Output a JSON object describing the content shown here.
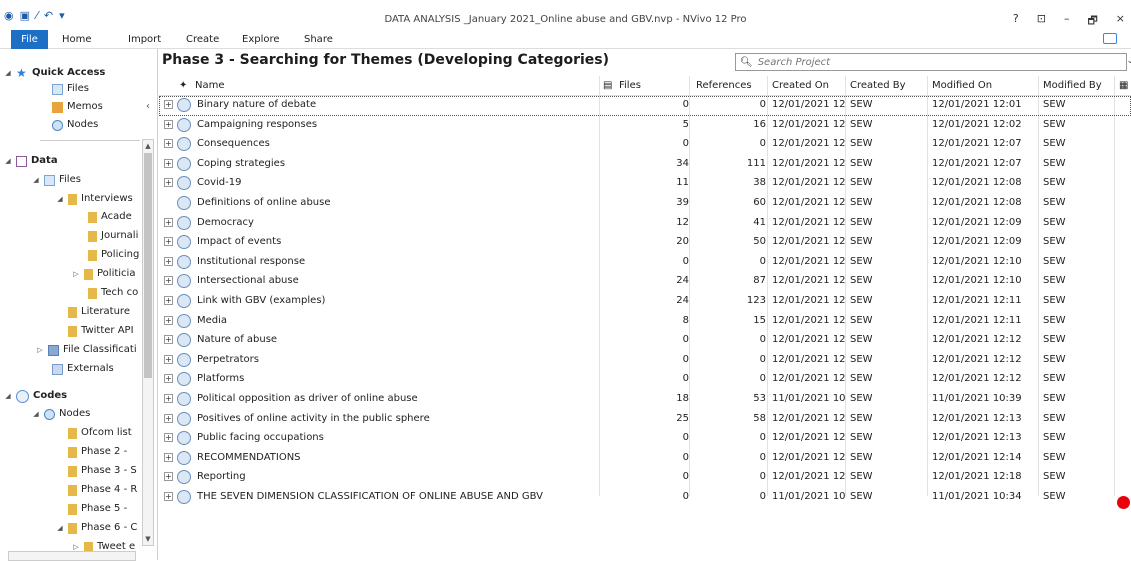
{
  "window": {
    "title": "DATA ANALYSIS _January 2021_Online abuse and GBV.nvp - NVivo 12 Pro",
    "controls": [
      "?",
      "⊡",
      "–",
      "🗗",
      "×"
    ]
  },
  "ribbon": {
    "tabs": [
      "File",
      "Home",
      "Import",
      "Create",
      "Explore",
      "Share"
    ]
  },
  "nav": {
    "quick_access": "Quick Access",
    "qa_files": "Files",
    "qa_memos": "Memos",
    "qa_nodes": "Nodes",
    "data": "Data",
    "files": "Files",
    "interviews": "Interviews",
    "acade": "Acade",
    "journali": "Journali",
    "policing": "Policing",
    "politicia": "Politicia",
    "tech": "Tech co",
    "literature": "Literature",
    "twitter": "Twitter API",
    "file_class": "File Classificati",
    "externals": "Externals",
    "codes": "Codes",
    "nodes": "Nodes",
    "ofcom": "Ofcom list",
    "phase2": "Phase 2 -",
    "phase3": "Phase 3 - S",
    "phase4": "Phase 4 - R",
    "phase5": "Phase 5 -",
    "phase6": "Phase 6 - C",
    "tweet": "Tweet e"
  },
  "main": {
    "title": "Phase 3 - Searching for Themes (Developing Categories)",
    "search_placeholder": "Search Project",
    "columns": {
      "name": "Name",
      "files": "Files",
      "references": "References",
      "created_on": "Created On",
      "created_by": "Created By",
      "modified_on": "Modified On",
      "modified_by": "Modified By"
    },
    "rows": [
      {
        "name": "Binary nature of debate",
        "files": "0",
        "refs": "0",
        "created_on": "12/01/2021 12",
        "created_by": "SEW",
        "modified_on": "12/01/2021 12:01",
        "modified_by": "SEW",
        "expand": true
      },
      {
        "name": "Campaigning responses",
        "files": "5",
        "refs": "16",
        "created_on": "12/01/2021 12",
        "created_by": "SEW",
        "modified_on": "12/01/2021 12:02",
        "modified_by": "SEW",
        "expand": true
      },
      {
        "name": "Consequences",
        "files": "0",
        "refs": "0",
        "created_on": "12/01/2021 12",
        "created_by": "SEW",
        "modified_on": "12/01/2021 12:07",
        "modified_by": "SEW",
        "expand": true
      },
      {
        "name": "Coping strategies",
        "files": "34",
        "refs": "111",
        "created_on": "12/01/2021 12",
        "created_by": "SEW",
        "modified_on": "12/01/2021 12:07",
        "modified_by": "SEW",
        "expand": true
      },
      {
        "name": "Covid-19",
        "files": "11",
        "refs": "38",
        "created_on": "12/01/2021 12",
        "created_by": "SEW",
        "modified_on": "12/01/2021 12:08",
        "modified_by": "SEW",
        "expand": true
      },
      {
        "name": "Definitions of online abuse",
        "files": "39",
        "refs": "60",
        "created_on": "12/01/2021 12",
        "created_by": "SEW",
        "modified_on": "12/01/2021 12:08",
        "modified_by": "SEW",
        "expand": false
      },
      {
        "name": "Democracy",
        "files": "12",
        "refs": "41",
        "created_on": "12/01/2021 12",
        "created_by": "SEW",
        "modified_on": "12/01/2021 12:09",
        "modified_by": "SEW",
        "expand": true
      },
      {
        "name": "Impact of events",
        "files": "20",
        "refs": "50",
        "created_on": "12/01/2021 12",
        "created_by": "SEW",
        "modified_on": "12/01/2021 12:09",
        "modified_by": "SEW",
        "expand": true
      },
      {
        "name": "Institutional response",
        "files": "0",
        "refs": "0",
        "created_on": "12/01/2021 12",
        "created_by": "SEW",
        "modified_on": "12/01/2021 12:10",
        "modified_by": "SEW",
        "expand": true
      },
      {
        "name": "Intersectional abuse",
        "files": "24",
        "refs": "87",
        "created_on": "12/01/2021 12",
        "created_by": "SEW",
        "modified_on": "12/01/2021 12:10",
        "modified_by": "SEW",
        "expand": true
      },
      {
        "name": "Link with GBV (examples)",
        "files": "24",
        "refs": "123",
        "created_on": "12/01/2021 12",
        "created_by": "SEW",
        "modified_on": "12/01/2021 12:11",
        "modified_by": "SEW",
        "expand": true
      },
      {
        "name": "Media",
        "files": "8",
        "refs": "15",
        "created_on": "12/01/2021 12",
        "created_by": "SEW",
        "modified_on": "12/01/2021 12:11",
        "modified_by": "SEW",
        "expand": true
      },
      {
        "name": "Nature of abuse",
        "files": "0",
        "refs": "0",
        "created_on": "12/01/2021 12",
        "created_by": "SEW",
        "modified_on": "12/01/2021 12:12",
        "modified_by": "SEW",
        "expand": true
      },
      {
        "name": "Perpetrators",
        "files": "0",
        "refs": "0",
        "created_on": "12/01/2021 12",
        "created_by": "SEW",
        "modified_on": "12/01/2021 12:12",
        "modified_by": "SEW",
        "expand": true
      },
      {
        "name": "Platforms",
        "files": "0",
        "refs": "0",
        "created_on": "12/01/2021 12",
        "created_by": "SEW",
        "modified_on": "12/01/2021 12:12",
        "modified_by": "SEW",
        "expand": true
      },
      {
        "name": "Political opposition as driver of online abuse",
        "files": "18",
        "refs": "53",
        "created_on": "11/01/2021 10",
        "created_by": "SEW",
        "modified_on": "11/01/2021 10:39",
        "modified_by": "SEW",
        "expand": true
      },
      {
        "name": "Positives of online activity in the public sphere",
        "files": "25",
        "refs": "58",
        "created_on": "12/01/2021 12",
        "created_by": "SEW",
        "modified_on": "12/01/2021 12:13",
        "modified_by": "SEW",
        "expand": true
      },
      {
        "name": "Public facing occupations",
        "files": "0",
        "refs": "0",
        "created_on": "12/01/2021 12",
        "created_by": "SEW",
        "modified_on": "12/01/2021 12:13",
        "modified_by": "SEW",
        "expand": true
      },
      {
        "name": "RECOMMENDATIONS",
        "files": "0",
        "refs": "0",
        "created_on": "12/01/2021 12",
        "created_by": "SEW",
        "modified_on": "12/01/2021 12:14",
        "modified_by": "SEW",
        "expand": true
      },
      {
        "name": "Reporting",
        "files": "0",
        "refs": "0",
        "created_on": "12/01/2021 12",
        "created_by": "SEW",
        "modified_on": "12/01/2021 12:18",
        "modified_by": "SEW",
        "expand": true
      },
      {
        "name": "THE SEVEN DIMENSION CLASSIFICATION OF ONLINE ABUSE AND GBV",
        "files": "0",
        "refs": "0",
        "created_on": "11/01/2021 10",
        "created_by": "SEW",
        "modified_on": "11/01/2021 10:34",
        "modified_by": "SEW",
        "expand": true
      }
    ]
  },
  "colors": {
    "file_tab": "#1d6fc6",
    "record_dot": "#e8000b"
  }
}
